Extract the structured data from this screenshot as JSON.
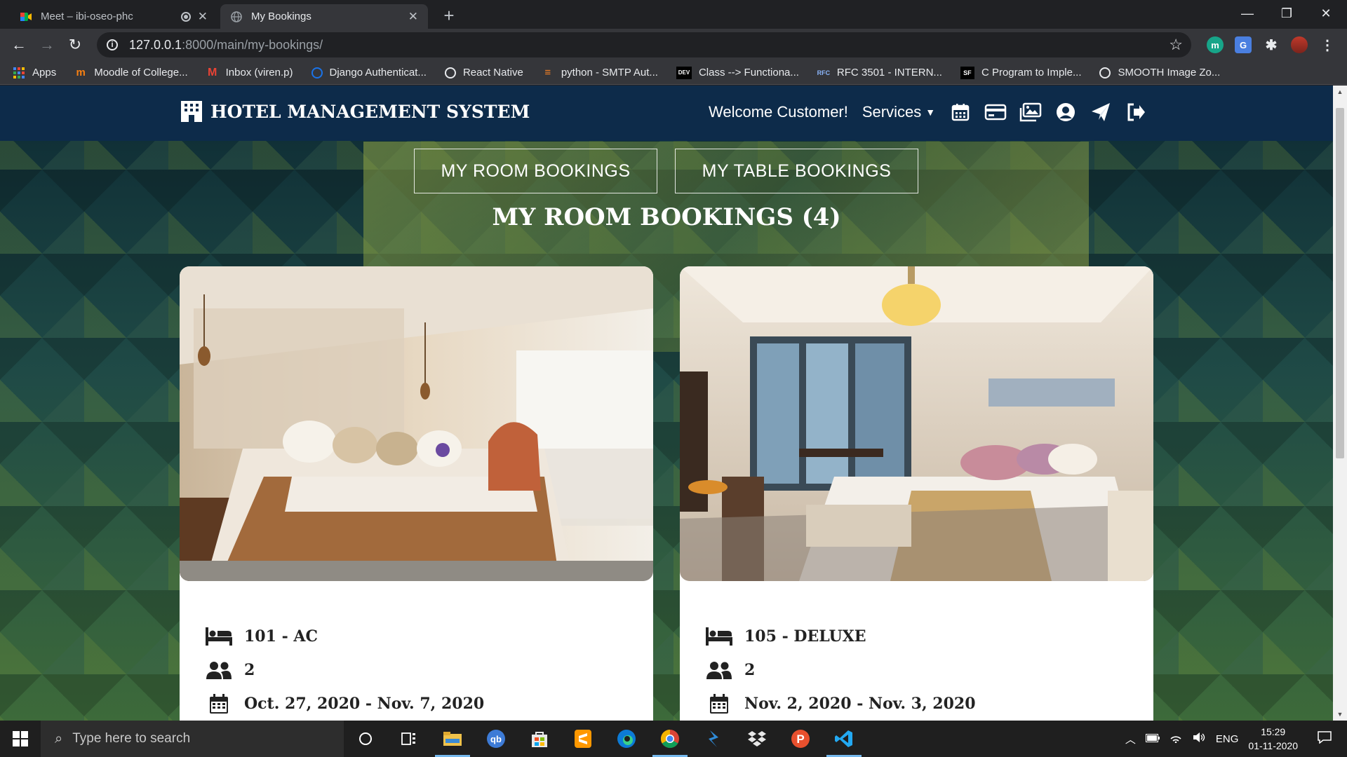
{
  "browser": {
    "tabs": [
      {
        "title": "Meet – ibi-oseo-phc",
        "active": false
      },
      {
        "title": "My Bookings",
        "active": true
      }
    ],
    "url_host": "127.0.0.1",
    "url_rest": ":8000/main/my-bookings/",
    "bookmarks": [
      {
        "label": "Apps",
        "icon": "apps-grid-icon"
      },
      {
        "label": "Moodle of College...",
        "icon": "moodle-icon"
      },
      {
        "label": "Inbox (viren.p)",
        "icon": "gmail-icon"
      },
      {
        "label": "Django Authenticat...",
        "icon": "django-icon"
      },
      {
        "label": "React Native",
        "icon": "globe-icon"
      },
      {
        "label": "python - SMTP Aut...",
        "icon": "stackoverflow-icon"
      },
      {
        "label": "Class --> Functiona...",
        "icon": "dev-icon"
      },
      {
        "label": "RFC 3501 - INTERN...",
        "icon": "rfc-icon"
      },
      {
        "label": "C Program to Imple...",
        "icon": "sf-icon"
      },
      {
        "label": "SMOOTH Image Zo...",
        "icon": "globe-icon"
      }
    ]
  },
  "site": {
    "brand": "HOTEL MANAGEMENT SYSTEM",
    "welcome": "Welcome Customer!",
    "services": "Services",
    "nav_icons": [
      "calendar-icon",
      "credit-card-icon",
      "gallery-icon",
      "user-circle-icon",
      "paper-plane-icon",
      "sign-out-icon"
    ],
    "tab_room": "MY ROOM BOOKINGS",
    "tab_table": "MY TABLE BOOKINGS",
    "section_title": "MY ROOM BOOKINGS (4)",
    "bookings": [
      {
        "room": "101 - AC",
        "guests": "2",
        "dates": "Oct. 27, 2020 - Nov. 7, 2020"
      },
      {
        "room": "105 - DELUXE",
        "guests": "2",
        "dates": "Nov. 2, 2020 - Nov. 3, 2020"
      }
    ]
  },
  "taskbar": {
    "search_placeholder": "Type here to search",
    "lang": "ENG",
    "time": "15:29",
    "date": "01-11-2020"
  }
}
